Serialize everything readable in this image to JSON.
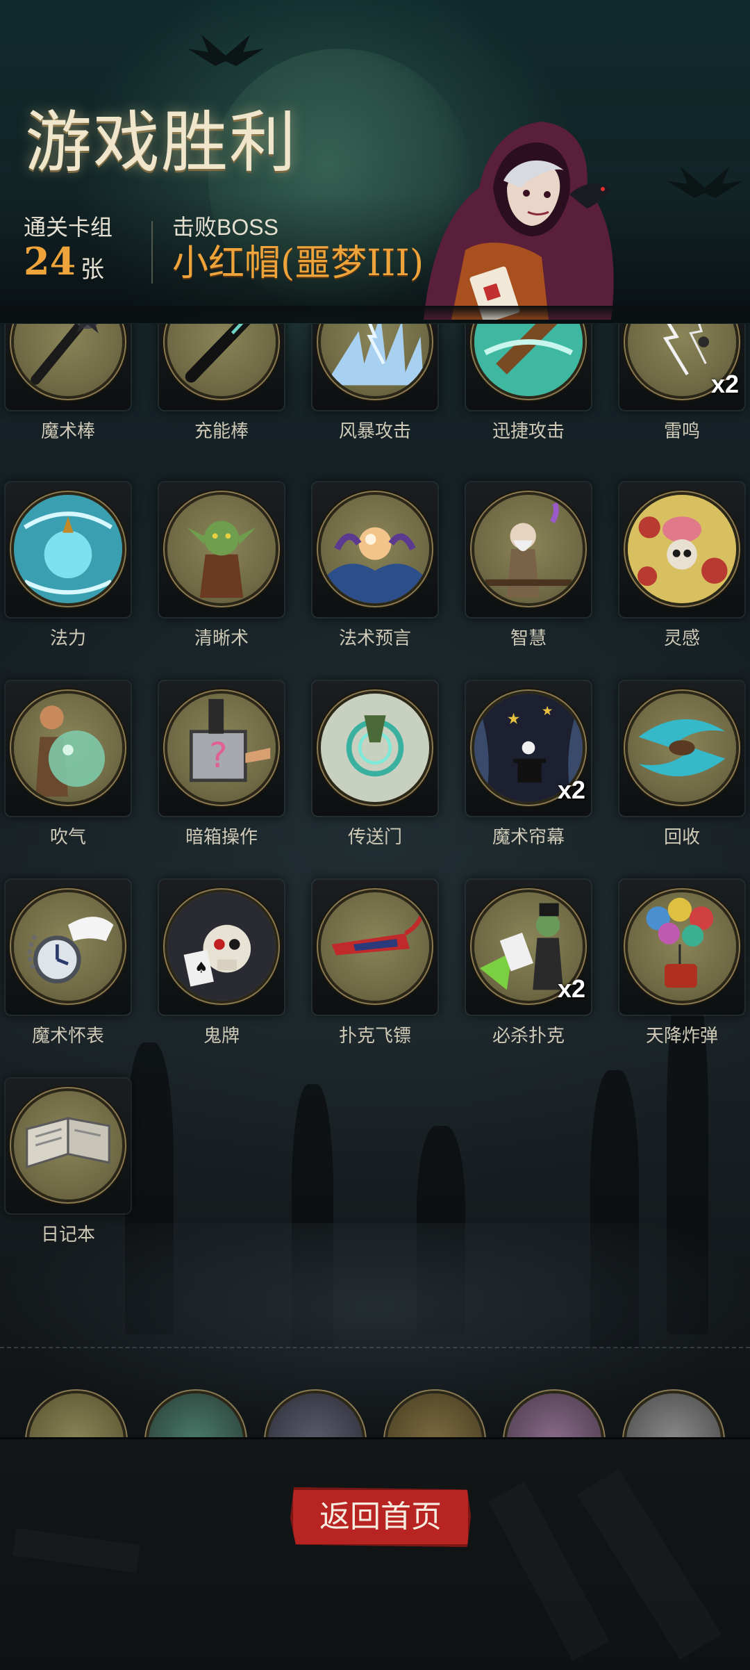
{
  "header": {
    "title": "游戏胜利",
    "clear_deck_label": "通关卡组",
    "card_count": "24",
    "card_unit": "张",
    "defeat_boss_label": "击败BOSS",
    "boss_name": "小红帽(噩梦III)"
  },
  "cards": [
    {
      "label": "魔术棒",
      "icon": "magic-wand-icon",
      "count": ""
    },
    {
      "label": "充能棒",
      "icon": "charge-wand-icon",
      "count": ""
    },
    {
      "label": "风暴攻击",
      "icon": "storm-attack-icon",
      "count": ""
    },
    {
      "label": "迅捷攻击",
      "icon": "swift-attack-icon",
      "count": ""
    },
    {
      "label": "雷鸣",
      "icon": "thunder-icon",
      "count": "x2"
    },
    {
      "label": "法力",
      "icon": "mana-icon",
      "count": ""
    },
    {
      "label": "清晰术",
      "icon": "clarity-goblin-icon",
      "count": ""
    },
    {
      "label": "法术预言",
      "icon": "crystal-ball-icon",
      "count": ""
    },
    {
      "label": "智慧",
      "icon": "wise-sage-icon",
      "count": ""
    },
    {
      "label": "灵感",
      "icon": "brain-skull-icon",
      "count": ""
    },
    {
      "label": "吹气",
      "icon": "bubble-blower-icon",
      "count": ""
    },
    {
      "label": "暗箱操作",
      "icon": "mystery-box-icon",
      "count": ""
    },
    {
      "label": "传送门",
      "icon": "portal-icon",
      "count": ""
    },
    {
      "label": "魔术帘幕",
      "icon": "magic-curtain-icon",
      "count": "x2"
    },
    {
      "label": "回收",
      "icon": "recycle-swirl-icon",
      "count": ""
    },
    {
      "label": "魔术怀表",
      "icon": "pocket-watch-icon",
      "count": ""
    },
    {
      "label": "鬼牌",
      "icon": "joker-skull-icon",
      "count": ""
    },
    {
      "label": "扑克飞镖",
      "icon": "card-dart-icon",
      "count": ""
    },
    {
      "label": "必杀扑克",
      "icon": "deadly-poker-icon",
      "count": "x2"
    },
    {
      "label": "天降炸弹",
      "icon": "balloon-bomb-icon",
      "count": ""
    },
    {
      "label": "日记本",
      "icon": "diary-book-icon",
      "count": ""
    }
  ],
  "footer": {
    "home_button": "返回首页"
  },
  "colors": {
    "accent_gold": "#eea43a",
    "button_red": "#b82421",
    "disc_olive": "#7a7550"
  }
}
